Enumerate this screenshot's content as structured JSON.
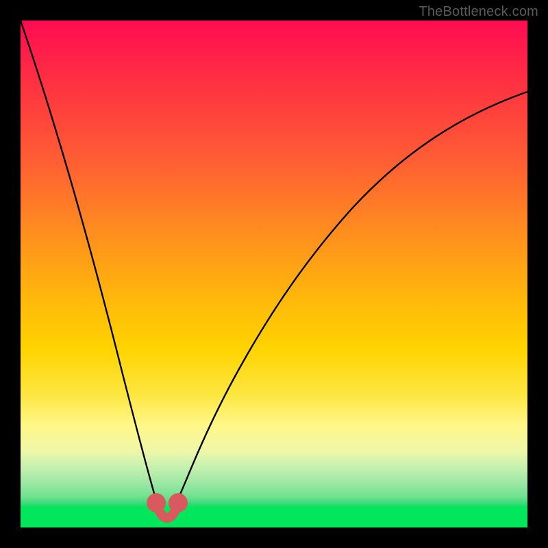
{
  "watermark": "TheBottleneck.com",
  "colors": {
    "page_bg": "#000000",
    "curve": "#000000",
    "marker": "#d85a5e",
    "gradient_top": "#ff0b53",
    "gradient_bottom": "#01e65a"
  },
  "chart_data": {
    "type": "line",
    "title": "",
    "xlabel": "",
    "ylabel": "",
    "xlim": [
      0,
      100
    ],
    "ylim": [
      0,
      100
    ],
    "grid": false,
    "legend": false,
    "x": [
      0,
      1,
      2,
      3,
      4,
      5,
      6,
      7,
      8,
      9,
      10,
      11,
      12,
      13,
      14,
      15,
      16,
      17,
      18,
      19,
      20,
      21,
      22,
      23,
      24,
      25,
      26,
      27,
      28,
      29,
      30,
      31,
      32,
      33,
      34,
      35,
      40,
      45,
      50,
      55,
      60,
      65,
      70,
      75,
      80,
      85,
      90,
      95,
      100
    ],
    "y_left_branch_x": [
      0,
      2,
      4,
      6,
      8,
      10,
      12,
      14,
      16,
      18,
      20,
      21,
      22,
      23,
      24,
      25,
      26,
      27,
      28
    ],
    "y_left_branch_y": [
      100,
      95,
      90,
      85,
      79,
      72,
      65,
      58,
      51,
      43,
      35,
      30,
      25,
      20,
      15,
      10,
      6,
      3,
      0
    ],
    "y_right_branch_x": [
      28,
      29,
      30,
      31,
      32,
      33,
      34,
      35,
      38,
      41,
      44,
      47,
      50,
      54,
      58,
      62,
      66,
      70,
      74,
      78,
      82,
      86,
      90,
      94,
      97,
      100
    ],
    "y_right_branch_y": [
      0,
      3,
      7,
      11,
      15,
      19,
      23,
      26,
      33,
      39,
      44,
      48,
      52,
      56,
      60,
      63,
      66,
      68.5,
      71,
      73,
      74.8,
      76.3,
      77.6,
      78.7,
      79.5,
      80
    ],
    "markers": {
      "type": "scatter",
      "shape": "round",
      "color": "#d85a5e",
      "points": [
        {
          "x": 26.0,
          "y": 4.0
        },
        {
          "x": 27.0,
          "y": 1.5
        },
        {
          "x": 28.0,
          "y": 0.5
        },
        {
          "x": 29.0,
          "y": 1.5
        },
        {
          "x": 30.0,
          "y": 4.0
        }
      ]
    },
    "notes": "Values estimated from pixel positions on a 0–100 normalized axis. Curve drops steeply from top-left to a minimum near x≈28, then rises with diminishing slope toward top-right. Minimum region highlighted with pink rounded markers forming a small U shape."
  }
}
